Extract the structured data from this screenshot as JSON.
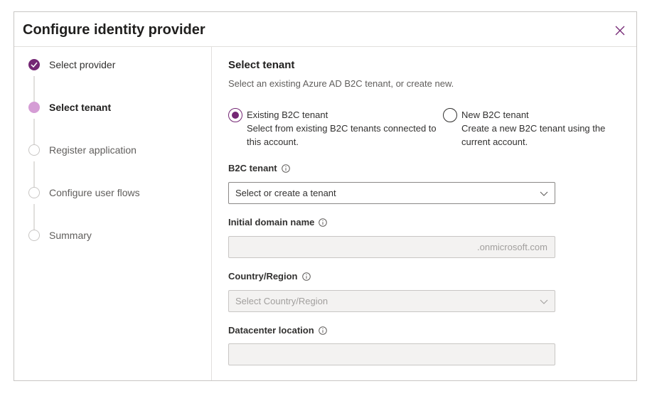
{
  "dialog": {
    "title": "Configure identity provider"
  },
  "steps": [
    {
      "label": "Select provider",
      "state": "done"
    },
    {
      "label": "Select tenant",
      "state": "current"
    },
    {
      "label": "Register application",
      "state": "pending"
    },
    {
      "label": "Configure user flows",
      "state": "pending"
    },
    {
      "label": "Summary",
      "state": "pending"
    }
  ],
  "section": {
    "title": "Select tenant",
    "description": "Select an existing Azure AD B2C tenant, or create new."
  },
  "options": [
    {
      "title": "Existing B2C tenant",
      "description": "Select from existing B2C tenants connected to this account.",
      "checked": true
    },
    {
      "title": "New B2C tenant",
      "description": "Create a new B2C tenant using the current account.",
      "checked": false
    }
  ],
  "fields": {
    "tenant": {
      "label": "B2C tenant",
      "placeholder": "Select or create a tenant"
    },
    "domain": {
      "label": "Initial domain name",
      "suffix": ".onmicrosoft.com",
      "value": ""
    },
    "country": {
      "label": "Country/Region",
      "placeholder": "Select Country/Region"
    },
    "datacenter": {
      "label": "Datacenter location",
      "value": ""
    }
  },
  "colors": {
    "accent": "#742774",
    "accent_light": "#d59dd5"
  }
}
